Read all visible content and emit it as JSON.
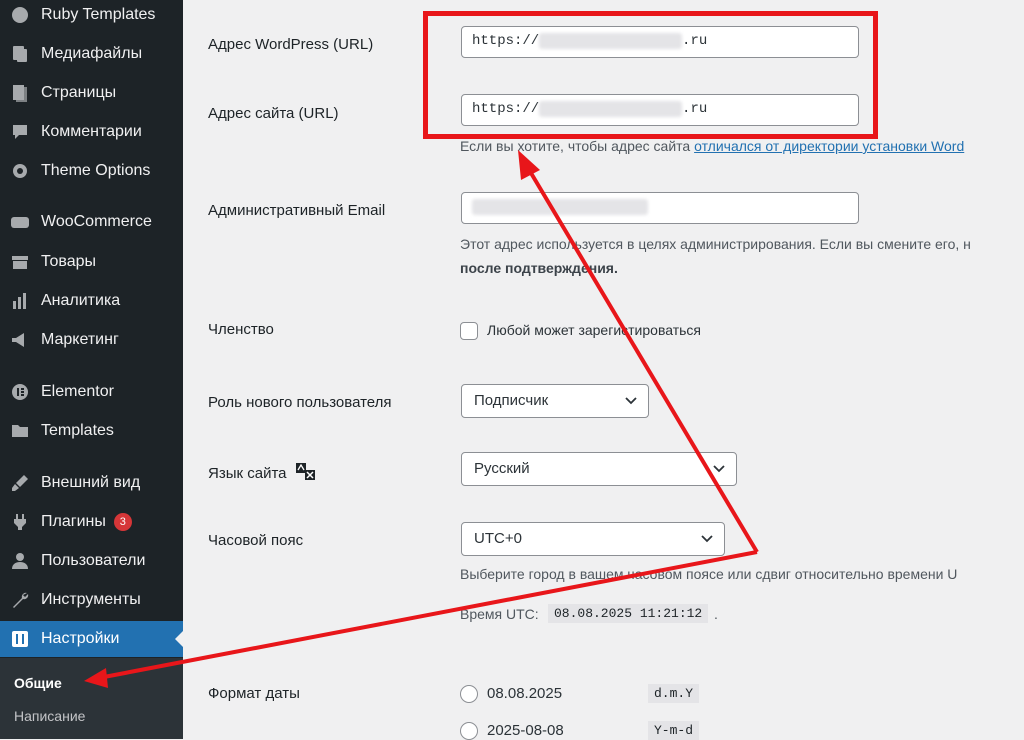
{
  "sidebar": {
    "items": [
      {
        "label": "Ruby Templates",
        "icon": "palette-icon"
      },
      {
        "label": "Медиафайлы",
        "icon": "media-icon"
      },
      {
        "label": "Страницы",
        "icon": "pages-icon"
      },
      {
        "label": "Комментарии",
        "icon": "comments-icon"
      },
      {
        "label": "Theme Options",
        "icon": "gear-icon"
      },
      {
        "label": "WooCommerce",
        "icon": "woo-icon"
      },
      {
        "label": "Товары",
        "icon": "products-icon"
      },
      {
        "label": "Аналитика",
        "icon": "analytics-icon"
      },
      {
        "label": "Маркетинг",
        "icon": "marketing-icon"
      },
      {
        "label": "Elementor",
        "icon": "elementor-icon"
      },
      {
        "label": "Templates",
        "icon": "folder-icon"
      },
      {
        "label": "Внешний вид",
        "icon": "brush-icon"
      },
      {
        "label": "Плагины",
        "icon": "plugin-icon",
        "badge": "3"
      },
      {
        "label": "Пользователи",
        "icon": "user-icon"
      },
      {
        "label": "Инструменты",
        "icon": "wrench-icon"
      },
      {
        "label": "Настройки",
        "icon": "settings-icon",
        "active": true
      }
    ],
    "submenu": [
      {
        "label": "Общие",
        "current": true
      },
      {
        "label": "Написание"
      }
    ]
  },
  "form": {
    "wp_url": {
      "label": "Адрес WordPress (URL)",
      "prefix": "https://",
      "suffix": ".ru"
    },
    "site_url": {
      "label": "Адрес сайта (URL)",
      "prefix": "https://",
      "suffix": ".ru"
    },
    "site_url_desc": {
      "text": "Если вы хотите, чтобы адрес сайта ",
      "link": "отличался от директории установки Word"
    },
    "admin_email": {
      "label": "Административный Email",
      "desc_line1": "Этот адрес используется в целях администрирования. Если вы смените его, н",
      "desc_line2": "после подтверждения."
    },
    "membership": {
      "label": "Членство",
      "checkbox_label": "Любой может зарегистироваться"
    },
    "default_role": {
      "label": "Роль нового пользователя",
      "value": "Подписчик"
    },
    "site_language": {
      "label": "Язык сайта",
      "value": "Русский"
    },
    "timezone": {
      "label": "Часовой пояс",
      "value": "UTC+0",
      "desc": "Выберите город в вашем часовом поясе или сдвиг относительно времени U",
      "utc_label": "Время UTC:",
      "utc_value": "08.08.2025 11:21:12"
    },
    "date_format": {
      "label": "Формат даты",
      "options": [
        {
          "text": "08.08.2025",
          "code": "d.m.Y"
        },
        {
          "text": "2025-08-08",
          "code": "Y-m-d"
        }
      ]
    }
  },
  "colors": {
    "accent": "#2271b1",
    "highlight": "#e8161a",
    "sidebar": "#1d2327"
  }
}
